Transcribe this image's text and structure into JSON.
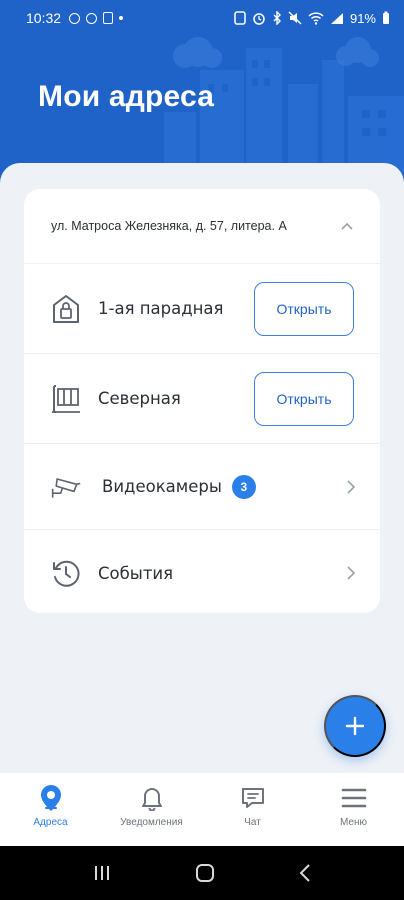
{
  "status_bar": {
    "time": "10:32",
    "battery": "91%"
  },
  "header": {
    "title": "Мои адреса"
  },
  "address": {
    "text": "ул. Матроса Железняка, д. 57, литера. А"
  },
  "doors": [
    {
      "label": "1-ая парадная",
      "icon": "entrance-lock-icon",
      "button_label": "Открыть"
    },
    {
      "label": "Северная",
      "icon": "gate-icon",
      "button_label": "Открыть"
    }
  ],
  "cameras": {
    "label": "Видеокамеры",
    "count": "3",
    "icon": "cctv-camera-icon"
  },
  "events": {
    "label": "События",
    "icon": "history-clock-icon"
  },
  "fab": {
    "icon": "plus-icon"
  },
  "bottom_nav": {
    "items": [
      {
        "label": "Адреса",
        "icon": "location-pin-icon",
        "active": true
      },
      {
        "label": "Уведомления",
        "icon": "bell-icon",
        "active": false
      },
      {
        "label": "Чат",
        "icon": "chat-icon",
        "active": false
      },
      {
        "label": "Меню",
        "icon": "hamburger-menu-icon",
        "active": false
      }
    ]
  },
  "colors": {
    "primary": "#1f63c9",
    "accent": "#2a7fe8",
    "background": "#eef1f6",
    "text": "#2b2f36",
    "muted": "#6d737c"
  }
}
